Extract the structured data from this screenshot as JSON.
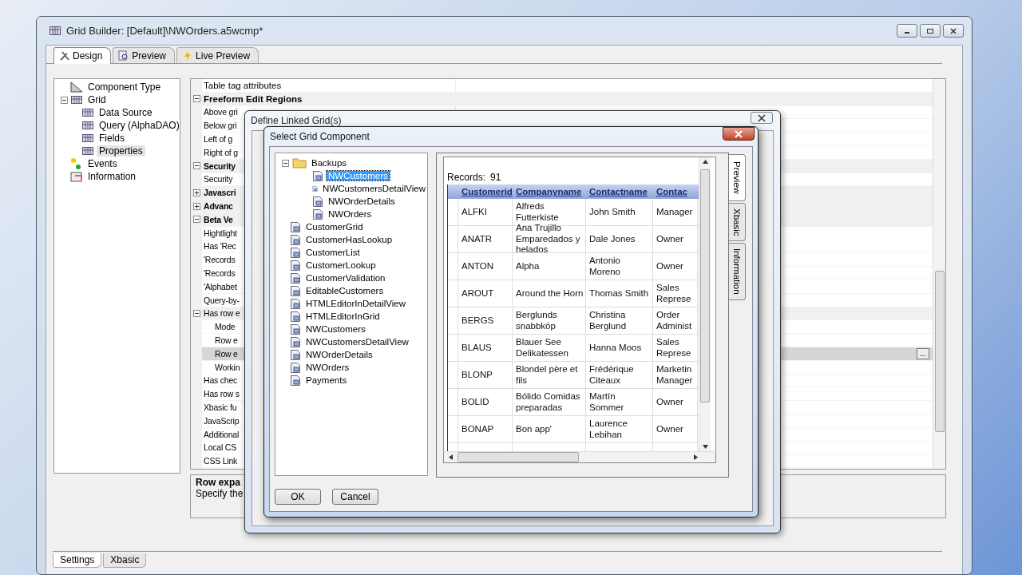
{
  "main_window": {
    "title": "Grid Builder: [Default]\\NWOrders.a5wcmp*"
  },
  "tabs": [
    {
      "label": "Design",
      "kind": "tools",
      "selected": true
    },
    {
      "label": "Preview",
      "kind": "magnifier",
      "selected": false
    },
    {
      "label": "Live Preview",
      "kind": "bolt",
      "selected": false
    }
  ],
  "component_tree": [
    {
      "label": "Component Type",
      "kind": "ruler",
      "selected": false
    },
    {
      "label": "Grid",
      "kind": "grid",
      "expanded": true,
      "selected": false,
      "children": [
        {
          "label": "Data Source",
          "selected": false
        },
        {
          "label": "Query (AlphaDAO)",
          "selected": false
        },
        {
          "label": "Fields",
          "selected": false
        },
        {
          "label": "Properties",
          "selected": true
        }
      ]
    },
    {
      "label": "Events",
      "kind": "events",
      "selected": false
    },
    {
      "label": "Information",
      "kind": "info",
      "selected": false
    }
  ],
  "properties": [
    {
      "kind": "prop",
      "name": "Table tag attributes",
      "selected": false
    },
    {
      "kind": "section",
      "name": "Freeform Edit Regions",
      "expanded": true
    },
    {
      "kind": "prop",
      "name": "Above gri",
      "selected": false
    },
    {
      "kind": "prop",
      "name": "Below gri",
      "selected": false
    },
    {
      "kind": "prop",
      "name": "Left of g",
      "selected": false
    },
    {
      "kind": "prop",
      "name": "Right of g",
      "selected": false
    },
    {
      "kind": "section",
      "name": "Security",
      "expanded": true
    },
    {
      "kind": "prop",
      "name": "Security",
      "selected": false
    },
    {
      "kind": "section",
      "name": "Javascri",
      "expanded": false
    },
    {
      "kind": "section",
      "name": "Advanc",
      "expanded": false
    },
    {
      "kind": "section",
      "name": "Beta Ve",
      "expanded": true
    },
    {
      "kind": "prop",
      "name": "Hightlight",
      "selected": false
    },
    {
      "kind": "prop",
      "name": "Has 'Rec",
      "selected": false
    },
    {
      "kind": "prop",
      "name": "'Records",
      "selected": false
    },
    {
      "kind": "prop",
      "name": "'Records",
      "selected": false
    },
    {
      "kind": "prop",
      "name": "'Alphabet",
      "selected": false
    },
    {
      "kind": "prop",
      "name": "Query-by-",
      "selected": false
    },
    {
      "kind": "group",
      "name": "Has row e",
      "expanded": true
    },
    {
      "kind": "sub",
      "name": "Mode",
      "selected": false
    },
    {
      "kind": "sub",
      "name": "Row e",
      "selected": false
    },
    {
      "kind": "sub",
      "name": "Row e",
      "selected": true,
      "button": "..."
    },
    {
      "kind": "sub",
      "name": "Workin",
      "selected": false
    },
    {
      "kind": "prop",
      "name": "Has chec",
      "selected": false
    },
    {
      "kind": "prop",
      "name": "Has row s",
      "selected": false
    },
    {
      "kind": "prop",
      "name": "Xbasic fu",
      "selected": false
    },
    {
      "kind": "prop",
      "name": "JavaScrip",
      "selected": false
    },
    {
      "kind": "prop",
      "name": "Additional",
      "selected": false
    },
    {
      "kind": "prop",
      "name": "Local CS",
      "selected": false
    },
    {
      "kind": "prop",
      "name": "CSS Link",
      "selected": false
    }
  ],
  "description": {
    "title": "Row expa",
    "text": "Specify the"
  },
  "bottom_tabs": [
    {
      "label": "Settings",
      "selected": true
    },
    {
      "label": "Xbasic",
      "selected": false
    }
  ],
  "linked_dialog": {
    "title": "Define Linked Grid(s)"
  },
  "select_dialog": {
    "title": "Select Grid Component",
    "tree": [
      {
        "label": "Backups",
        "kind": "folder",
        "expanded": true,
        "selected": false,
        "children": [
          {
            "label": "NWCustomers",
            "selected": true
          },
          {
            "label": "NWCustomersDetailView",
            "selected": false
          },
          {
            "label": "NWOrderDetails",
            "selected": false
          },
          {
            "label": "NWOrders",
            "selected": false
          }
        ]
      },
      {
        "label": "CustomerGrid",
        "kind": "component",
        "selected": false
      },
      {
        "label": "CustomerHasLookup",
        "kind": "component",
        "selected": false
      },
      {
        "label": "CustomerList",
        "kind": "component",
        "selected": false
      },
      {
        "label": "CustomerLookup",
        "kind": "component",
        "selected": false
      },
      {
        "label": "CustomerValidation",
        "kind": "component",
        "selected": false
      },
      {
        "label": "EditableCustomers",
        "kind": "component",
        "selected": false
      },
      {
        "label": "HTMLEditorInDetailView",
        "kind": "component",
        "selected": false
      },
      {
        "label": "HTMLEditorInGrid",
        "kind": "component",
        "selected": false
      },
      {
        "label": "NWCustomers",
        "kind": "component",
        "selected": false
      },
      {
        "label": "NWCustomersDetailView",
        "kind": "component",
        "selected": false
      },
      {
        "label": "NWOrderDetails",
        "kind": "component",
        "selected": false
      },
      {
        "label": "NWOrders",
        "kind": "component",
        "selected": false
      },
      {
        "label": "Payments",
        "kind": "component",
        "selected": false
      }
    ],
    "records_label": "Records:",
    "records_count": "91",
    "columns": [
      "Customerid",
      "Companyname",
      "Contactname",
      "Contac"
    ],
    "rows": [
      [
        "ALFKI",
        "Alfreds Futterkiste",
        "John Smith",
        "Manager"
      ],
      [
        "ANATR",
        "Ana Trujillo Emparedados y helados",
        "Dale Jones",
        "Owner"
      ],
      [
        "ANTON",
        "Alpha",
        "Antonio Moreno",
        "Owner"
      ],
      [
        "AROUT",
        "Around the Horn",
        "Thomas Smith",
        "Sales Represe"
      ],
      [
        "BERGS",
        "Berglunds snabbköp",
        "Christina Berglund",
        "Order Administ"
      ],
      [
        "BLAUS",
        "Blauer See Delikatessen",
        "Hanna Moos",
        "Sales Represe"
      ],
      [
        "BLONP",
        "Blondel père et fils",
        "Frédérique Citeaux",
        "Marketin Manager"
      ],
      [
        "BOLID",
        "Bólido Comidas preparadas",
        "Martín Sommer",
        "Owner"
      ],
      [
        "BONAP",
        "Bon app'",
        "Laurence Lebihan",
        "Owner"
      ]
    ],
    "side_tabs": [
      {
        "label": "Preview",
        "selected": true
      },
      {
        "label": "Xbasic",
        "selected": false
      },
      {
        "label": "Information",
        "selected": false
      }
    ],
    "buttons": [
      "OK",
      "Cancel"
    ]
  }
}
